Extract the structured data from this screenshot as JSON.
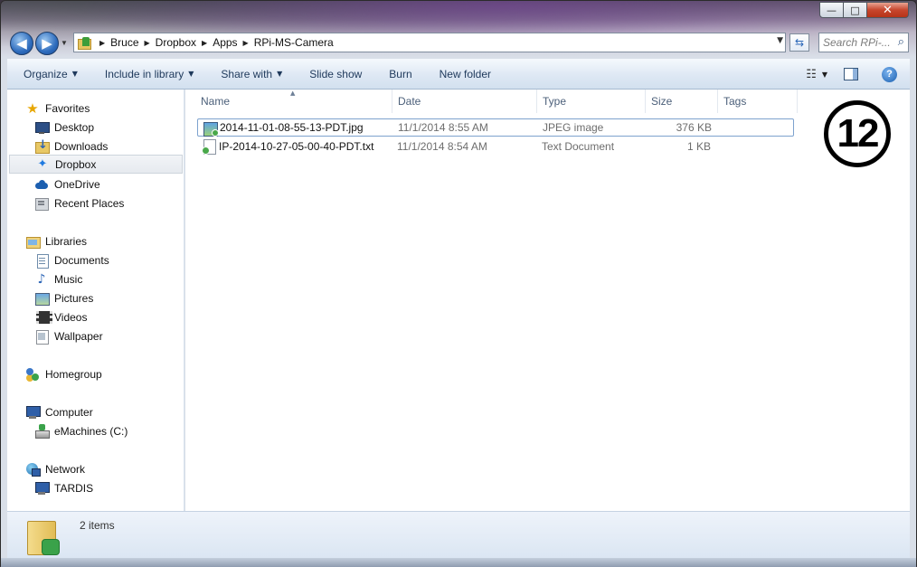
{
  "window": {
    "caption_minimize": "—",
    "caption_maximize": "□",
    "caption_close": "✕"
  },
  "navigation": {
    "back_glyph": "◀",
    "forward_glyph": "▶",
    "breadcrumbs": [
      "Bruce",
      "Dropbox",
      "Apps",
      "RPi-MS-Camera"
    ],
    "search_placeholder": "Search RPi-..."
  },
  "toolbar": {
    "organize": "Organize",
    "include_in_library": "Include in library",
    "share_with": "Share with",
    "slide_show": "Slide show",
    "burn": "Burn",
    "new_folder": "New folder",
    "help": "?"
  },
  "sidebar": {
    "favorites": "Favorites",
    "desktop": "Desktop",
    "downloads": "Downloads",
    "dropbox": "Dropbox",
    "onedrive": "OneDrive",
    "recent_places": "Recent Places",
    "libraries": "Libraries",
    "documents": "Documents",
    "music": "Music",
    "pictures": "Pictures",
    "videos": "Videos",
    "wallpaper": "Wallpaper",
    "homegroup": "Homegroup",
    "computer": "Computer",
    "emachines": "eMachines (C:)",
    "network": "Network",
    "tardis": "TARDIS",
    "selected": "Dropbox"
  },
  "file_list": {
    "columns": {
      "name": "Name",
      "date": "Date",
      "type": "Type",
      "size": "Size",
      "tags": "Tags"
    },
    "rows": [
      {
        "name": "2014-11-01-08-55-13-PDT.jpg",
        "date": "11/1/2014 8:55 AM",
        "type": "JPEG image",
        "size": "376 KB",
        "icon": "jpeg-file-icon"
      },
      {
        "name": "IP-2014-10-27-05-00-40-PDT.txt",
        "date": "11/1/2014 8:54 AM",
        "type": "Text Document",
        "size": "1 KB",
        "icon": "text-file-icon"
      }
    ]
  },
  "annotation": {
    "number": "12"
  },
  "details": {
    "item_count": "2 items"
  },
  "colors": {
    "toolbar_text": "#1e395b",
    "selection_border": "#7da2ce",
    "column_header_text": "#4c607a",
    "secondary_text": "#6d6d6d"
  }
}
